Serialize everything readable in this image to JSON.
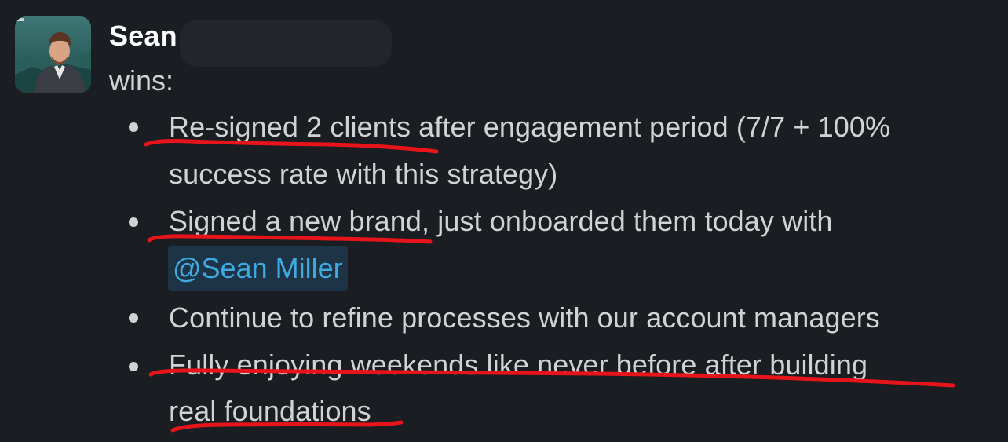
{
  "message": {
    "sender": "Sean",
    "intro": "wins:",
    "bullets": [
      {
        "lines": [
          "Re-signed 2 clients after engagement period (7/7 + 100%",
          "success rate with this strategy)"
        ]
      },
      {
        "line1": "Signed a new brand, just onboarded them today with",
        "mention": "@Sean Miller"
      },
      {
        "lines": [
          "Continue to refine processes with our account managers"
        ]
      },
      {
        "lines": [
          "Fully enjoying weekends like never before after building",
          "real foundations"
        ]
      }
    ]
  },
  "colors": {
    "background": "#1a1d21",
    "text": "#d1d2d3",
    "mention_text": "#3fa9e0",
    "mention_bg": "#1d3446",
    "annotation": "#e8141b"
  },
  "icons": {
    "avatar": "user-photo"
  }
}
